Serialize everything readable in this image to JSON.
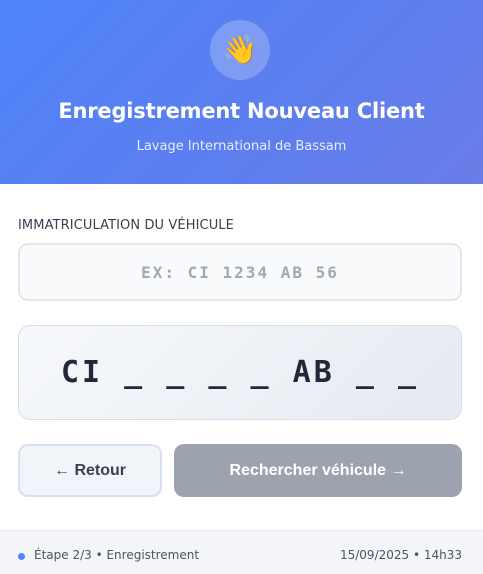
{
  "header": {
    "icon": "waving-hand-icon",
    "icon_glyph": "👋",
    "title": "Enregistrement Nouveau Client",
    "subtitle": "Lavage International de Bassam",
    "gradient_colors": [
      "#4f84fb",
      "#6a7de8"
    ]
  },
  "form": {
    "plate_label": "IMMATRICULATION DU VÉHICULE",
    "plate_placeholder": "EX: CI 1234 AB 56",
    "plate_value": "",
    "plate_preview": "CI _ _ _ _ AB _ _"
  },
  "actions": {
    "back_label": "← Retour",
    "search_label": "Rechercher véhicule →",
    "search_color": "#9ca3af"
  },
  "footer": {
    "step": "Étape 2/3 • Enregistrement",
    "timestamp": "15/09/2025 • 14h33",
    "accent": "#4f84fb"
  }
}
